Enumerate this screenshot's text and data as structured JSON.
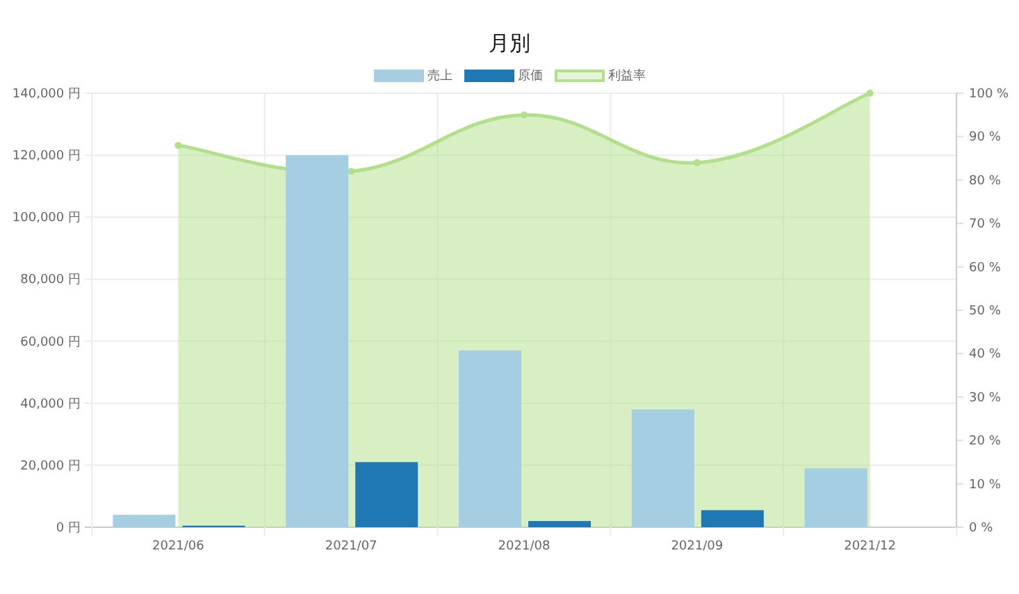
{
  "chart": {
    "title": "月別",
    "chart_data": {
      "type": "bar",
      "categories": [
        "2021/06",
        "2021/07",
        "2021/08",
        "2021/09",
        "2021/12"
      ],
      "series": [
        {
          "name": "売上",
          "color": "#a6cee3",
          "values": [
            4000,
            120000,
            57000,
            38000,
            19000
          ]
        },
        {
          "name": "原価",
          "color": "#1f78b4",
          "values": [
            500,
            21000,
            2000,
            5500,
            0
          ]
        },
        {
          "name": "利益率",
          "type": "area",
          "axis": "y2",
          "color": "#b2df8a",
          "values": [
            88,
            82,
            95,
            84,
            100
          ]
        }
      ],
      "stacked": false,
      "grid": true,
      "ylim": [
        0,
        140000
      ],
      "yticks": [
        {
          "value": 0,
          "label": "0 円"
        },
        {
          "value": 20000,
          "label": "20,000 円"
        },
        {
          "value": 40000,
          "label": "40,000 円"
        },
        {
          "value": 60000,
          "label": "60,000 円"
        },
        {
          "value": 80000,
          "label": "80,000 円"
        },
        {
          "value": 100000,
          "label": "100,000 円"
        },
        {
          "value": 120000,
          "label": "120,000 円"
        },
        {
          "value": 140000,
          "label": "140,000 円"
        }
      ],
      "y2lim": [
        0,
        100
      ],
      "y2ticks": [
        {
          "value": 0,
          "label": "0 %"
        },
        {
          "value": 10,
          "label": "10 %"
        },
        {
          "value": 20,
          "label": "20 %"
        },
        {
          "value": 30,
          "label": "30 %"
        },
        {
          "value": 40,
          "label": "40 %"
        },
        {
          "value": 50,
          "label": "50 %"
        },
        {
          "value": 60,
          "label": "60 %"
        },
        {
          "value": 70,
          "label": "70 %"
        },
        {
          "value": 80,
          "label": "80 %"
        },
        {
          "value": 90,
          "label": "90 %"
        },
        {
          "value": 100,
          "label": "100 %"
        }
      ]
    }
  }
}
